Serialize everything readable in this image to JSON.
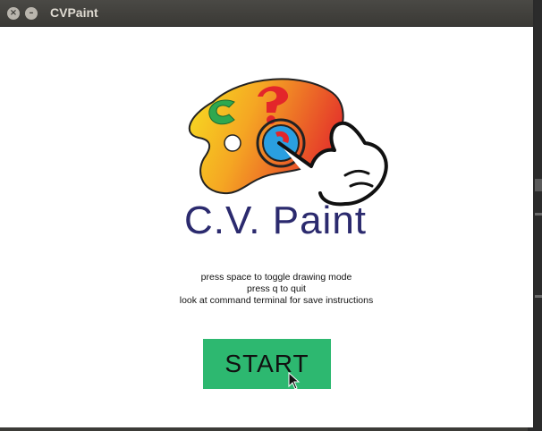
{
  "window": {
    "title": "CVPaint",
    "close_glyph": "×",
    "minimize_glyph": "–"
  },
  "splash": {
    "logo_icon": "palette-hand-icon",
    "app_name": "C.V. Paint",
    "instructions": [
      "press space to toggle drawing mode",
      "press q to quit",
      "look at command terminal for save instructions"
    ],
    "start_label": "START"
  },
  "colors": {
    "start_button": "#2db870",
    "app_name": "#2b2a6e",
    "titlebar": "#3c3b37"
  }
}
